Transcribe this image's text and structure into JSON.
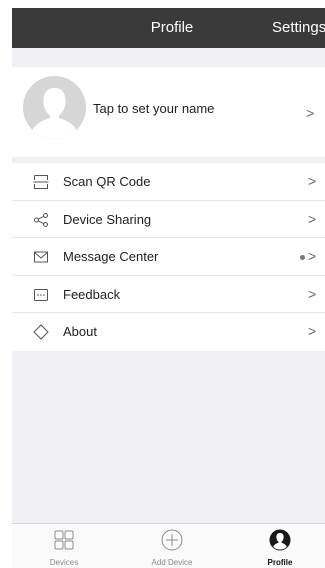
{
  "header": {
    "title": "Profile",
    "settings_label": "Settings"
  },
  "profile": {
    "name_hint": "Tap to set your name",
    "chevron": ">"
  },
  "menu": {
    "items": [
      {
        "label": "Scan QR Code",
        "icon": "qr-scan-icon",
        "chevron": ">"
      },
      {
        "label": "Device Sharing",
        "icon": "share-icon",
        "chevron": ">"
      },
      {
        "label": "Message Center",
        "icon": "envelope-icon",
        "chevron": ">"
      },
      {
        "label": "Feedback",
        "icon": "feedback-icon",
        "chevron": ">"
      },
      {
        "label": "About",
        "icon": "diamond-icon",
        "chevron": ">"
      }
    ]
  },
  "tabbar": {
    "tabs": [
      {
        "label": "Devices",
        "icon": "grid-icon"
      },
      {
        "label": "Add Device",
        "icon": "plus-circle-icon"
      },
      {
        "label": "Profile",
        "icon": "person-icon",
        "active": true
      }
    ]
  },
  "colors": {
    "navbar": "#3a3a3a",
    "background": "#efeff4",
    "card": "#ffffff"
  }
}
